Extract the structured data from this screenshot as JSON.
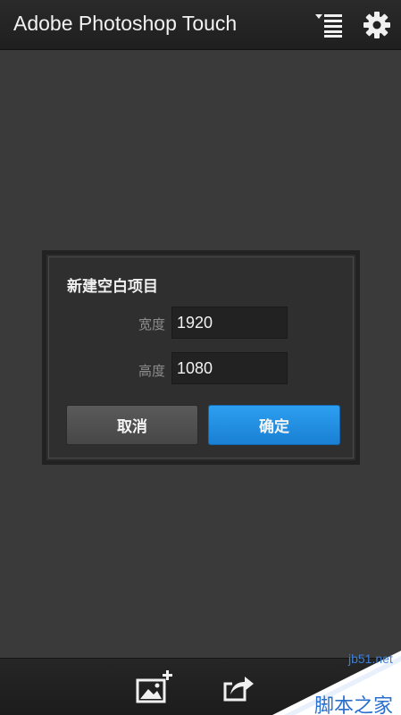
{
  "header": {
    "title": "Adobe Photoshop Touch",
    "menu_icon": "sort-list-icon",
    "settings_icon": "gear-icon"
  },
  "dialog": {
    "title": "新建空白项目",
    "width_label": "宽度",
    "width_value": "1920",
    "height_label": "高度",
    "height_value": "1080",
    "cancel_label": "取消",
    "confirm_label": "确定"
  },
  "bottom_bar": {
    "add_image_icon": "add-image-icon",
    "share_icon": "share-icon"
  },
  "watermark": {
    "site": "jb51.net",
    "name": "脚本之家"
  },
  "colors": {
    "background": "#3a3a3a",
    "header": "#222222",
    "accent": "#1f8ee3",
    "dialog": "#2f2f2f"
  }
}
